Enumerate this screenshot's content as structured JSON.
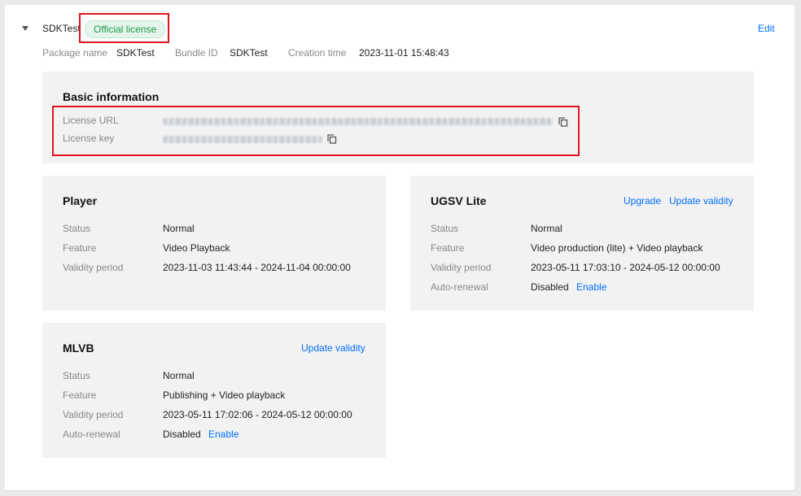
{
  "header": {
    "app_name": "SDKTest",
    "license_tag": "Official license",
    "edit_label": "Edit",
    "meta": [
      {
        "label": "Package name",
        "value": "SDKTest"
      },
      {
        "label": "Bundle ID",
        "value": "SDKTest"
      },
      {
        "label": "Creation time",
        "value": "2023-11-01 15:48:43"
      }
    ]
  },
  "basic": {
    "title": "Basic information",
    "url_label": "License URL",
    "key_label": "License key"
  },
  "player": {
    "title": "Player",
    "rows": [
      {
        "label": "Status",
        "value": "Normal"
      },
      {
        "label": "Feature",
        "value": "Video Playback"
      },
      {
        "label": "Validity period",
        "value": "2023-11-03 11:43:44 - 2024-11-04 00:00:00"
      }
    ]
  },
  "ugsv": {
    "title": "UGSV Lite",
    "upgrade_label": "Upgrade",
    "update_label": "Update validity",
    "rows": [
      {
        "label": "Status",
        "value": "Normal"
      },
      {
        "label": "Feature",
        "value": "Video production (lite) + Video playback"
      },
      {
        "label": "Validity period",
        "value": "2023-05-11 17:03:10 - 2024-05-12 00:00:00"
      },
      {
        "label": "Auto-renewal",
        "value": "Disabled",
        "action": "Enable"
      }
    ]
  },
  "mlvb": {
    "title": "MLVB",
    "update_label": "Update validity",
    "rows": [
      {
        "label": "Status",
        "value": "Normal"
      },
      {
        "label": "Feature",
        "value": "Publishing + Video playback"
      },
      {
        "label": "Validity period",
        "value": "2023-05-11 17:02:06 - 2024-05-12 00:00:00"
      },
      {
        "label": "Auto-renewal",
        "value": "Disabled",
        "action": "Enable"
      }
    ]
  },
  "colors": {
    "accent": "#006eff",
    "status_normal": "#29a152",
    "highlight": "#e0141e",
    "card_bg": "#f2f2f2"
  },
  "icons": [
    "caret-down-icon",
    "copy-icon"
  ]
}
